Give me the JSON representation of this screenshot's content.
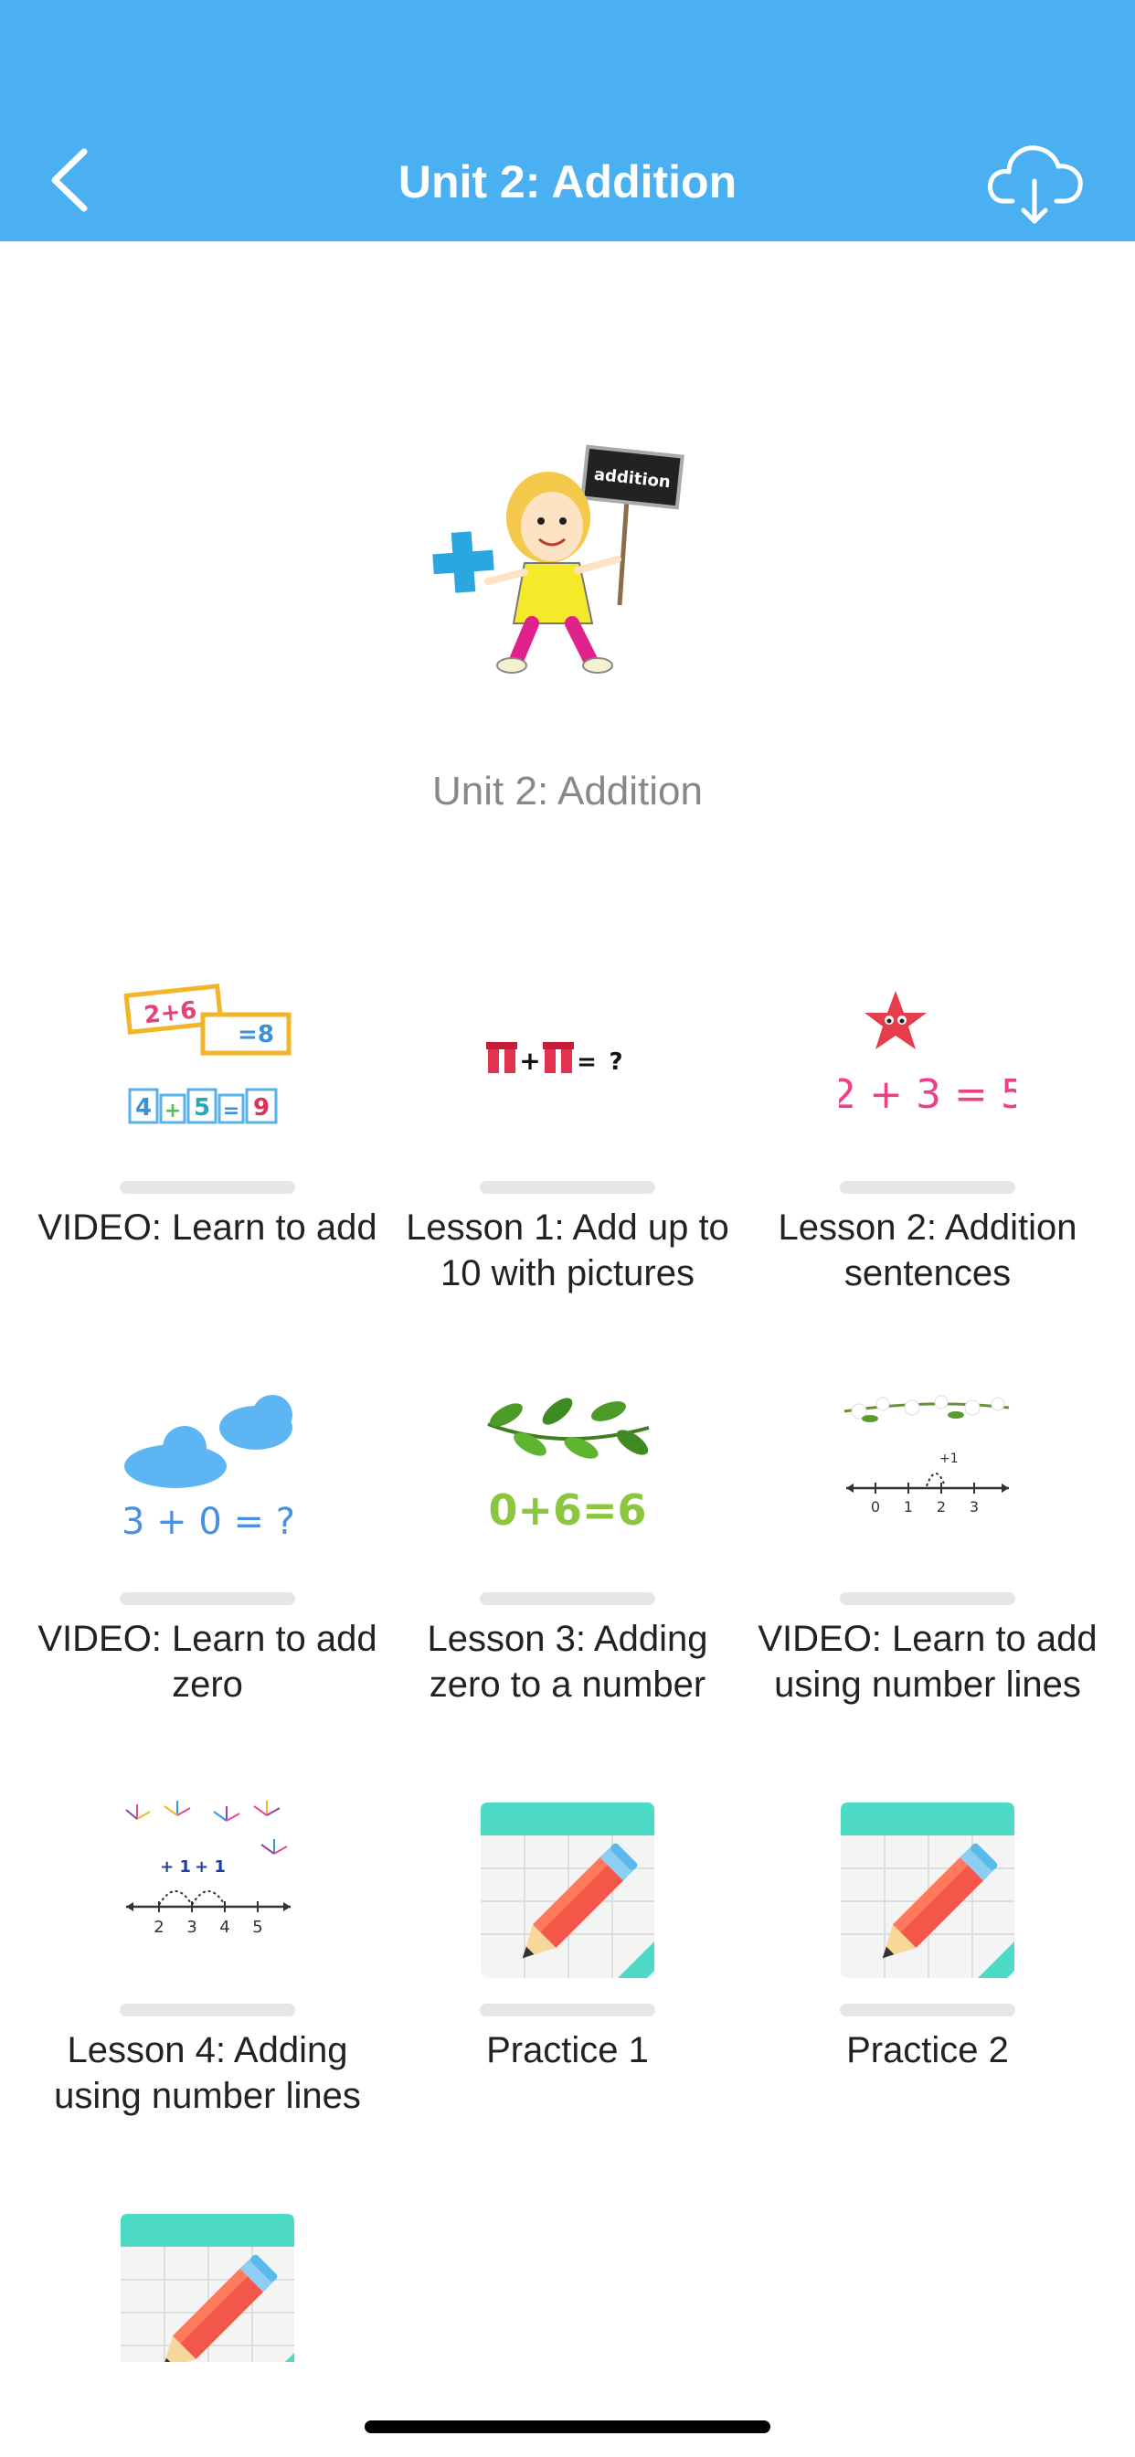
{
  "header": {
    "title": "Unit 2: Addition",
    "back_icon": "chevron-left-icon",
    "download_icon": "cloud-download-icon",
    "bg_color": "#4ab0f2"
  },
  "hero": {
    "caption": "Unit 2: Addition",
    "sign_text": "addition"
  },
  "lessons": [
    {
      "label": "VIDEO: Learn to add",
      "thumb": "addition-blocks"
    },
    {
      "label": "Lesson 1: Add up to 10 with pictures",
      "thumb": "gift-addition",
      "thumb_text": "+ = ?"
    },
    {
      "label": "Lesson 2: Addition sentences",
      "thumb": "star-equation",
      "thumb_text": "2 + 3 = 5"
    },
    {
      "label": "VIDEO: Learn to add zero",
      "thumb": "clouds-equation",
      "thumb_text": "3 + 0 = ?"
    },
    {
      "label": "Lesson 3: Adding zero to a number",
      "thumb": "leaves-equation",
      "thumb_text": "0+6=6"
    },
    {
      "label": "VIDEO: Learn to add using number lines",
      "thumb": "number-line-flowers",
      "ticks": [
        "0",
        "1",
        "2",
        "3"
      ]
    },
    {
      "label": "Lesson 4: Adding using number lines",
      "thumb": "number-line-fireworks",
      "ticks": [
        "2",
        "3",
        "4",
        "5"
      ],
      "jumps": [
        "+ 1",
        "+ 1"
      ]
    },
    {
      "label": "Practice 1",
      "thumb": "practice-pencil"
    },
    {
      "label": "Practice 2",
      "thumb": "practice-pencil"
    },
    {
      "label": "",
      "thumb": "practice-pencil"
    }
  ]
}
